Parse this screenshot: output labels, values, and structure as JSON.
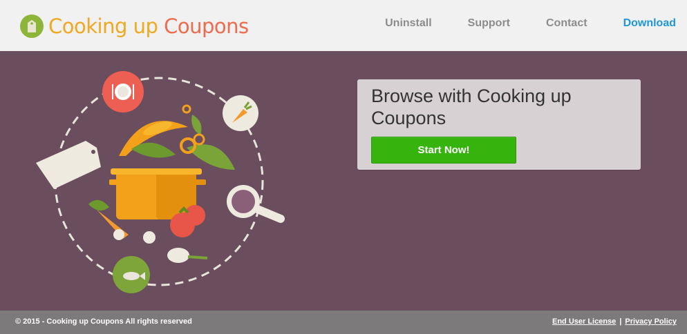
{
  "header": {
    "logo_word1": "Cooking up",
    "logo_word2": "Coupons",
    "nav": {
      "uninstall": "Uninstall",
      "support": "Support",
      "contact": "Contact",
      "download": "Download"
    }
  },
  "hero": {
    "headline": "Browse with Cooking up Coupons",
    "cta_label": "Start Now!"
  },
  "footer": {
    "copyright": "© 2015 - Cooking up Coupons All rights reserved",
    "eula": "End User License",
    "separator": "|",
    "privacy": "Privacy Policy"
  },
  "colors": {
    "background": "#6b4e5d",
    "header_bg": "#f1f1f1",
    "nav_text": "#8c8c8c",
    "download_link": "#1f97d6",
    "cta_green": "#36b30c",
    "footer_bg": "#7c7a7b",
    "logo_orange": "#f0a820",
    "logo_coral": "#ee6b4d"
  },
  "icons": [
    "logo-tag-icon",
    "plate-icon",
    "carrot-icon",
    "price-tag-icon",
    "magnifier-icon",
    "fish-icon",
    "cooking-pot-icon"
  ]
}
